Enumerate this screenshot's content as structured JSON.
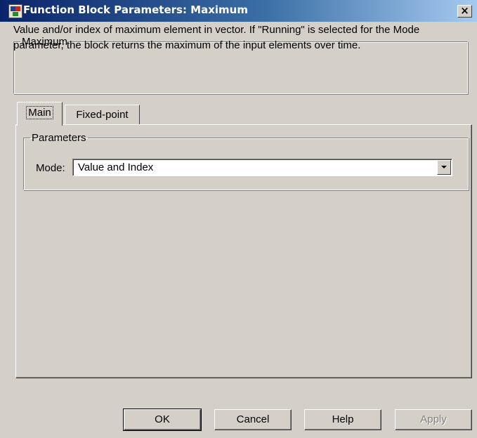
{
  "window": {
    "title": "Function Block Parameters: Maximum",
    "close_label": "×"
  },
  "block_group": {
    "legend": "Maximum",
    "description": "Value and/or index of maximum element in vector. If \"Running\" is selected for the Mode parameter, the block returns the maximum of the input elements over time."
  },
  "tabs": [
    {
      "label": "Main",
      "selected": true
    },
    {
      "label": "Fixed-point",
      "selected": false
    }
  ],
  "parameters": {
    "legend": "Parameters",
    "mode_label": "Mode:",
    "mode_value": "Value and Index"
  },
  "buttons": {
    "ok": "OK",
    "cancel": "Cancel",
    "help": "Help",
    "apply": "Apply",
    "apply_enabled": false
  },
  "colors": {
    "titlebar_start": "#0a246a",
    "titlebar_end": "#a6caf0",
    "face": "#d4d0c8"
  }
}
